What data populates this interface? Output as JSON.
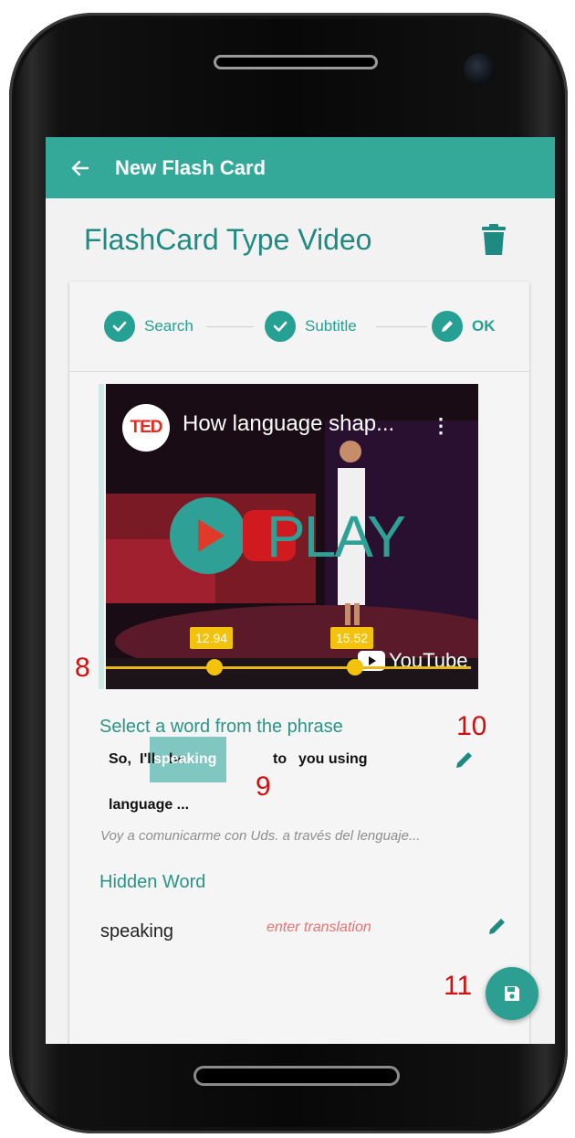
{
  "appbar": {
    "title": "New Flash Card"
  },
  "page": {
    "title": "FlashCard Type Video"
  },
  "stepper": {
    "steps": [
      {
        "label": "Search",
        "state": "done"
      },
      {
        "label": "Subtitle",
        "state": "done"
      },
      {
        "label": "OK",
        "state": "edit"
      }
    ]
  },
  "video": {
    "channel_logo": "TED",
    "title": "How language shap...",
    "play_overlay": "PLAY",
    "platform": "YouTube",
    "range_start": "12.94",
    "range_end": "15.52"
  },
  "phrase_section": {
    "label": "Select a word from the phrase",
    "words_line1": [
      "So,",
      "I'll",
      "be",
      "speaking",
      "to",
      "you using"
    ],
    "selected_word": "speaking",
    "line2": "language  ...",
    "translation": "Voy a comunicarme con Uds. a través del lenguaje..."
  },
  "hidden_section": {
    "label": "Hidden Word",
    "word": "speaking",
    "translation_placeholder": "enter translation"
  },
  "annotations": {
    "a8": "8",
    "a9": "9",
    "a10": "10",
    "a11": "11"
  },
  "colors": {
    "primary": "#34a99a",
    "accent": "#f2c20c",
    "annotation": "#d01010"
  }
}
